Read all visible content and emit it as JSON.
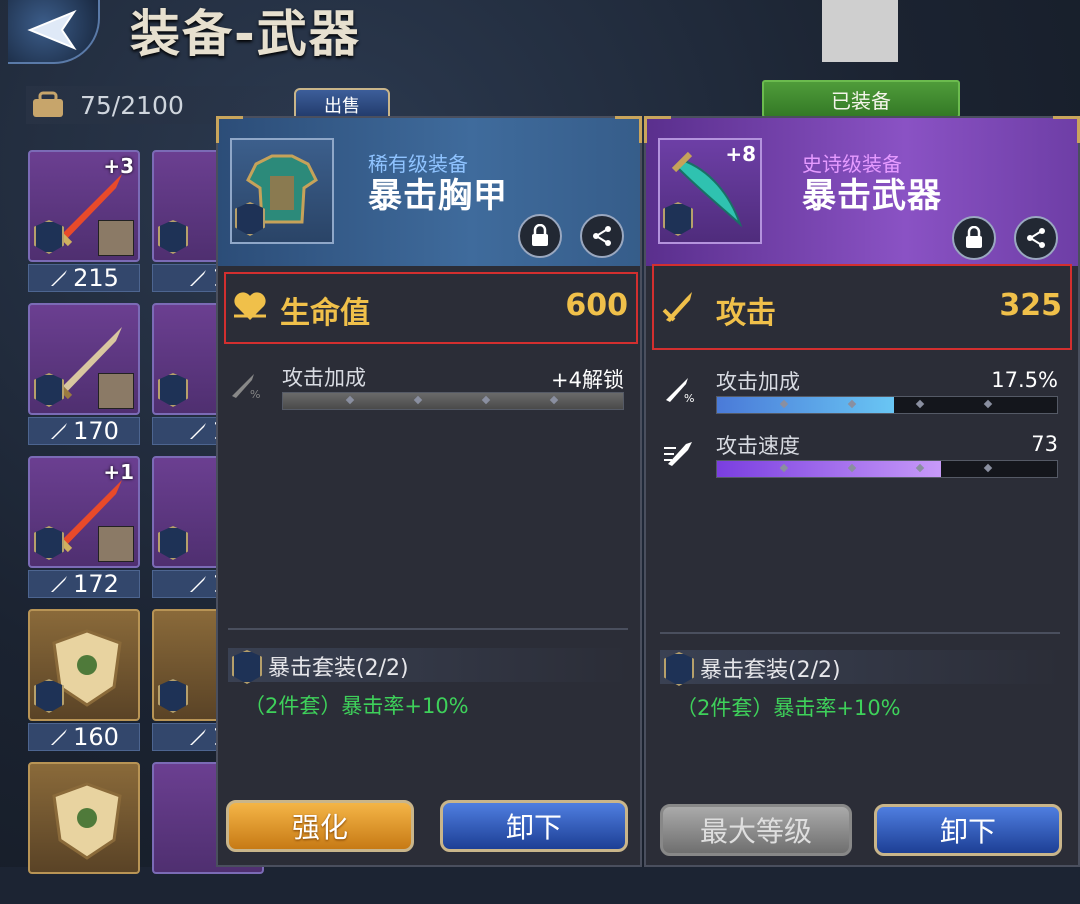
{
  "header": {
    "title": "装备-武器",
    "bag_count": "75/2100",
    "sell_label": "出售",
    "equipped_tag": "已装备"
  },
  "inventory": [
    {
      "level": "+3",
      "power": "215",
      "frame": "purple"
    },
    {
      "level": "",
      "power": "1",
      "frame": "purple"
    },
    {
      "level": "",
      "power": "170",
      "frame": "purple"
    },
    {
      "level": "",
      "power": "1",
      "frame": "purple"
    },
    {
      "level": "+1",
      "power": "172",
      "frame": "purple"
    },
    {
      "level": "",
      "power": "1",
      "frame": "purple"
    },
    {
      "level": "",
      "power": "160",
      "frame": "gold"
    },
    {
      "level": "",
      "power": "1",
      "frame": "gold"
    },
    {
      "level": "",
      "power": "",
      "frame": "gold"
    },
    {
      "level": "",
      "power": "",
      "frame": "purple"
    }
  ],
  "left_panel": {
    "rarity": "稀有级装备",
    "rarity_color": "#8fc3ff",
    "name": "暴击胸甲",
    "main_stat": {
      "label": "生命值",
      "value": "600"
    },
    "sub_stats": [
      {
        "label": "攻击加成",
        "value": "+4解锁",
        "fill": 0,
        "color": "#777"
      }
    ],
    "set_name": "暴击套装(2/2)",
    "set_bonus": "（2件套）暴击率+10%",
    "btn_primary": "强化",
    "btn_secondary": "卸下"
  },
  "right_panel": {
    "level": "+8",
    "rarity": "史诗级装备",
    "rarity_color": "#e59aff",
    "name": "暴击武器",
    "main_stat": {
      "label": "攻击",
      "value": "325"
    },
    "sub_stats": [
      {
        "label": "攻击加成",
        "value": "17.5%",
        "fill": 0.52,
        "color": "#5fb4f0"
      },
      {
        "label": "攻击速度",
        "value": "73",
        "fill": 0.66,
        "color": "#a070f0"
      }
    ],
    "set_name": "暴击套装(2/2)",
    "set_bonus": "（2件套）暴击率+10%",
    "btn_primary": "最大等级",
    "btn_secondary": "卸下"
  }
}
